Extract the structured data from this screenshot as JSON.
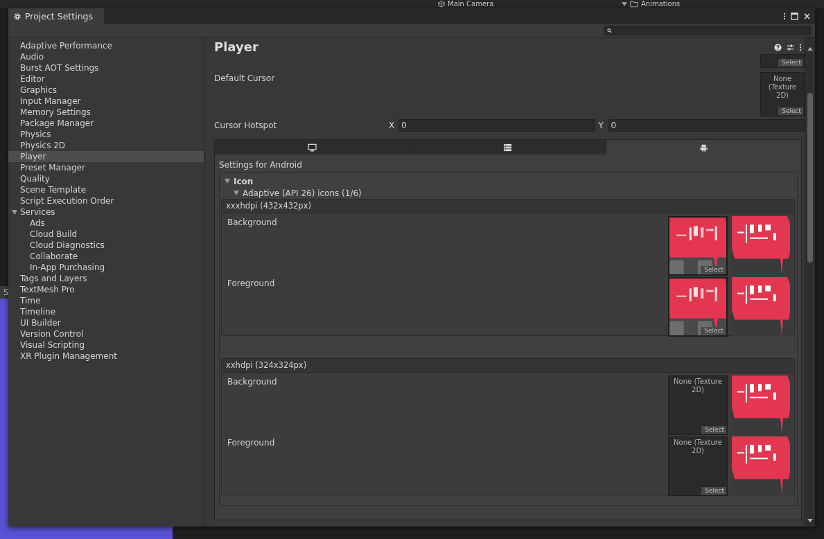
{
  "background": {
    "hierarchy_item": "Main Camera",
    "project_folder": "Animations",
    "left_tab": "S"
  },
  "window": {
    "title": "Project Settings"
  },
  "sidebar": {
    "items": [
      {
        "label": "Adaptive Performance",
        "selected": false
      },
      {
        "label": "Audio",
        "selected": false
      },
      {
        "label": "Burst AOT Settings",
        "selected": false
      },
      {
        "label": "Editor",
        "selected": false
      },
      {
        "label": "Graphics",
        "selected": false
      },
      {
        "label": "Input Manager",
        "selected": false
      },
      {
        "label": "Memory Settings",
        "selected": false
      },
      {
        "label": "Package Manager",
        "selected": false
      },
      {
        "label": "Physics",
        "selected": false
      },
      {
        "label": "Physics 2D",
        "selected": false
      },
      {
        "label": "Player",
        "selected": true
      },
      {
        "label": "Preset Manager",
        "selected": false
      },
      {
        "label": "Quality",
        "selected": false
      },
      {
        "label": "Scene Template",
        "selected": false
      },
      {
        "label": "Script Execution Order",
        "selected": false
      },
      {
        "label": "Services",
        "selected": false,
        "expanded": true,
        "children": [
          {
            "label": "Ads",
            "selected": false
          },
          {
            "label": "Cloud Build",
            "selected": false
          },
          {
            "label": "Cloud Diagnostics",
            "selected": false
          },
          {
            "label": "Collaborate",
            "selected": false
          },
          {
            "label": "In-App Purchasing",
            "selected": false
          }
        ]
      },
      {
        "label": "Tags and Layers",
        "selected": false
      },
      {
        "label": "TextMesh Pro",
        "selected": false
      },
      {
        "label": "Time",
        "selected": false
      },
      {
        "label": "Timeline",
        "selected": false
      },
      {
        "label": "UI Builder",
        "selected": false
      },
      {
        "label": "Version Control",
        "selected": false
      },
      {
        "label": "Visual Scripting",
        "selected": false
      },
      {
        "label": "XR Plugin Management",
        "selected": false
      }
    ]
  },
  "panel": {
    "title": "Player",
    "top_slot": {
      "button": "Select"
    },
    "default_cursor": {
      "label": "Default Cursor",
      "slot_text": "None (Texture 2D)",
      "button": "Select"
    },
    "cursor_hotspot": {
      "label": "Cursor Hotspot",
      "x_label": "X",
      "x_value": "0",
      "y_label": "Y",
      "y_value": "0"
    },
    "platform_tabs": [
      {
        "kind": "desktop",
        "selected": false
      },
      {
        "kind": "server",
        "selected": false
      },
      {
        "kind": "android",
        "selected": true
      }
    ],
    "settings_heading": "Settings for Android",
    "icon_section": {
      "title": "Icon",
      "expanded": true,
      "subsection": {
        "title": "Adaptive (API 26) icons (1/6)",
        "expanded": true
      },
      "groups": [
        {
          "title": "xxxhdpi (432x432px)",
          "rows": [
            {
              "label": "Background",
              "slot": {
                "kind": "picture",
                "button": "Select"
              }
            },
            {
              "label": "Foreground",
              "slot": {
                "kind": "picture",
                "button": "Select"
              }
            }
          ]
        },
        {
          "title": "xxhdpi (324x324px)",
          "rows": [
            {
              "label": "Background",
              "slot": {
                "kind": "empty",
                "text": "None (Texture 2D)",
                "button": "Select"
              }
            },
            {
              "label": "Foreground",
              "slot": {
                "kind": "empty",
                "text": "None (Texture 2D)",
                "button": "Select"
              }
            }
          ]
        }
      ]
    }
  }
}
